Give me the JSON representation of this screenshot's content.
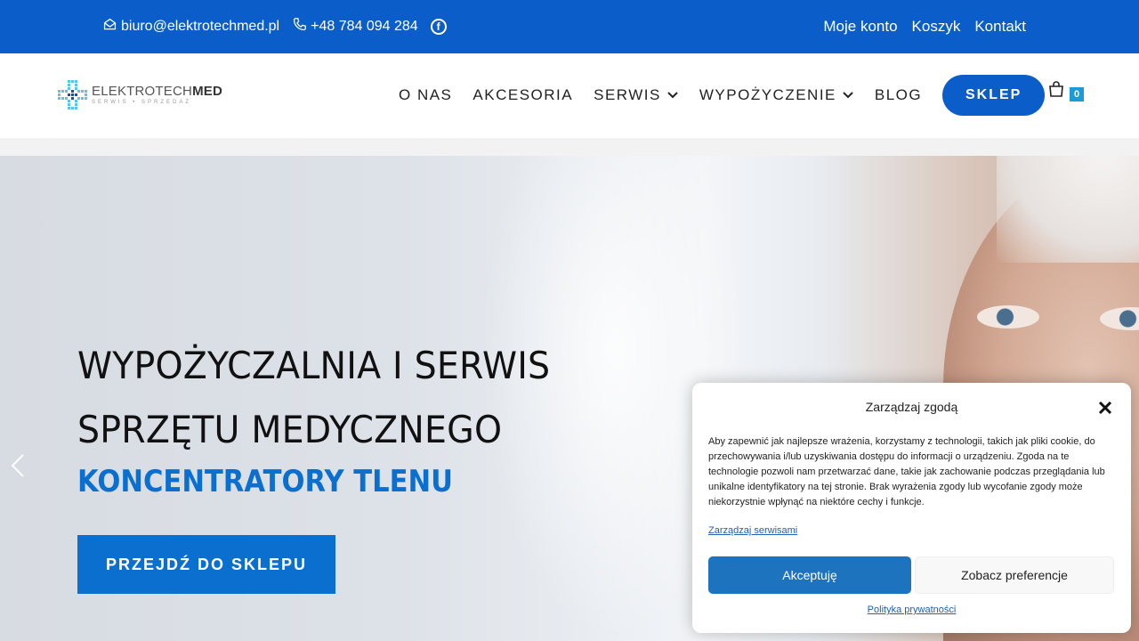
{
  "topbar": {
    "email": "biuro@elektrotechmed.pl",
    "phone": "+48 784 094 284",
    "facebook_icon": "f",
    "links": [
      "Moje konto",
      "Koszyk",
      "Kontakt"
    ]
  },
  "logo": {
    "brand_light": "ELEKTROTECH",
    "brand_bold": "MED",
    "tagline": "SERWIS • SPRZEDAŻ"
  },
  "nav": {
    "items": [
      "O NAS",
      "AKCESORIA",
      "SERWIS",
      "WYPOŻYCZENIE",
      "BLOG"
    ],
    "shop_label": "SKLEP",
    "cart_count": "0"
  },
  "hero": {
    "title_line1": "WYPOŻYCZALNIA I SERWIS",
    "title_line2": "SPRZĘTU MEDYCZNEGO",
    "subtitle": "KONCENTRATORY TLENU",
    "cta_label": "PRZEJDŹ DO SKLEPU"
  },
  "consent": {
    "title": "Zarządzaj zgodą",
    "body": "Aby zapewnić jak najlepsze wrażenia, korzystamy z technologii, takich jak pliki cookie, do przechowywania i/lub uzyskiwania dostępu do informacji o urządzeniu. Zgoda na te technologie pozwoli nam przetwarzać dane, takie jak zachowanie podczas przeglądania lub unikalne identyfikatory na tej stronie. Brak wyrażenia zgody lub wycofanie zgody może niekorzystnie wpłynąć na niektóre cechy i funkcje.",
    "manage_link": "Zarządzaj serwisami",
    "accept_label": "Akceptuję",
    "preferences_label": "Zobacz preferencje",
    "policy_link": "Polityka prywatności"
  },
  "colors": {
    "primary": "#0b5ec9",
    "accent": "#0b6fd0",
    "badge": "#1c9bd6"
  }
}
